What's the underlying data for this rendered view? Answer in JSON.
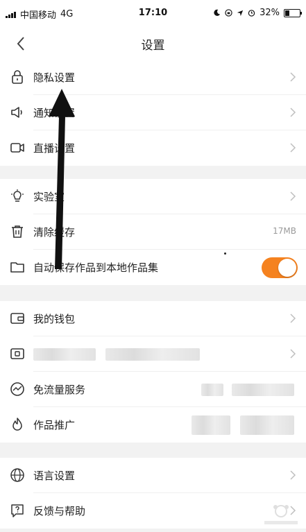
{
  "status_bar": {
    "carrier": "中国移动",
    "network": "4G",
    "time": "17:10",
    "battery": "32%",
    "battery_level": 0.32
  },
  "nav": {
    "title": "设置"
  },
  "groups": {
    "g1": [
      {
        "label": "隐私设置",
        "icon": "lock-icon"
      },
      {
        "label": "通知设置",
        "icon": "speaker-icon"
      },
      {
        "label": "直播设置",
        "icon": "video-icon"
      }
    ],
    "g2": [
      {
        "label": "实验室",
        "icon": "lightbulb-icon"
      },
      {
        "label": "清除缓存",
        "icon": "trash-icon",
        "value": "17MB"
      },
      {
        "label": "自动保存作品到本地作品集",
        "icon": "folder-icon",
        "toggle_on": true
      }
    ],
    "g3": [
      {
        "label": "我的钱包",
        "icon": "wallet-icon"
      },
      {
        "label": "",
        "icon": "card-icon"
      },
      {
        "label": "免流量服务",
        "icon": "traffic-icon"
      },
      {
        "label": "作品推广",
        "icon": "flame-icon"
      }
    ],
    "g4": [
      {
        "label": "语言设置",
        "icon": "globe-icon"
      },
      {
        "label": "反馈与帮助",
        "icon": "help-icon"
      }
    ]
  },
  "colors": {
    "accent": "#f5821f",
    "background": "#f2f2f2",
    "chevron": "#bfbfbf"
  }
}
